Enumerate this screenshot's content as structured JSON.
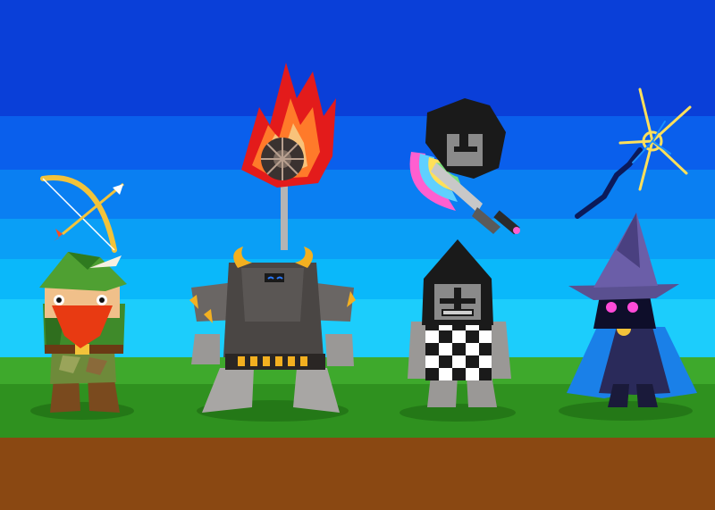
{
  "scene": {
    "sky_bands": [
      "#0a3fe0",
      "#0a6cf0",
      "#0a8ef5",
      "#0aaff8",
      "#12c7fb",
      "#2ad8fd"
    ],
    "ground_colors": {
      "grass_top": "#3aa82a",
      "grass_bottom": "#2a8a1e",
      "dirt": "#8a4a14"
    }
  },
  "characters": [
    {
      "id": "ranger",
      "weapon_icon": "bow-and-arrow-icon"
    },
    {
      "id": "warrior",
      "weapon_icon": "flaming-mace-icon"
    },
    {
      "id": "knight",
      "weapon_icon": "rainbow-sword-icon"
    },
    {
      "id": "wizard",
      "weapon_icon": "lightning-staff-icon"
    }
  ]
}
